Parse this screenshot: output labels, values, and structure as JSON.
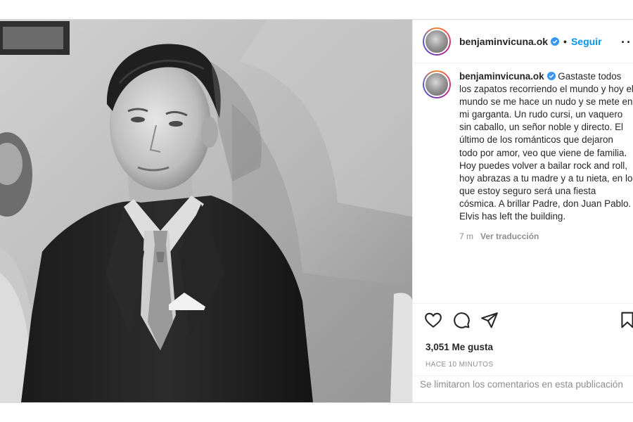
{
  "post": {
    "username": "benjaminvicuna.ok",
    "separator": "•",
    "follow_label": "Seguir",
    "more_label": "···",
    "caption_text": "Gastaste todos los zapatos recorriendo el mundo y hoy el mundo se me hace un nudo y se mete en mi garganta. Un rudo cursi, un vaquero sin caballo, un señor noble y directo. El último de los románticos que dejaron todo por amor, veo que viene de familia. Hoy puedes volver a bailar rock and roll, hoy abrazas a tu madre y a tu nieta, en lo que estoy seguro será una fiesta cósmica. A brillar Padre, don Juan Pablo.\nElvis has left the building.",
    "caption_age": "7 m",
    "translate_label": "Ver traducción",
    "likes": "3,051 Me gusta",
    "posted_time": "HACE 10 MINUTOS",
    "comments_notice": "Se limitaron los comentarios en esta publicación"
  },
  "icons": {
    "verified": "verified-badge-icon",
    "like": "heart-icon",
    "comment": "comment-bubble-icon",
    "share": "paper-plane-icon",
    "save": "bookmark-icon"
  },
  "colors": {
    "accent": "#0095f6",
    "verified": "#3897f0",
    "text": "#262626",
    "muted": "#8e8e8e"
  }
}
